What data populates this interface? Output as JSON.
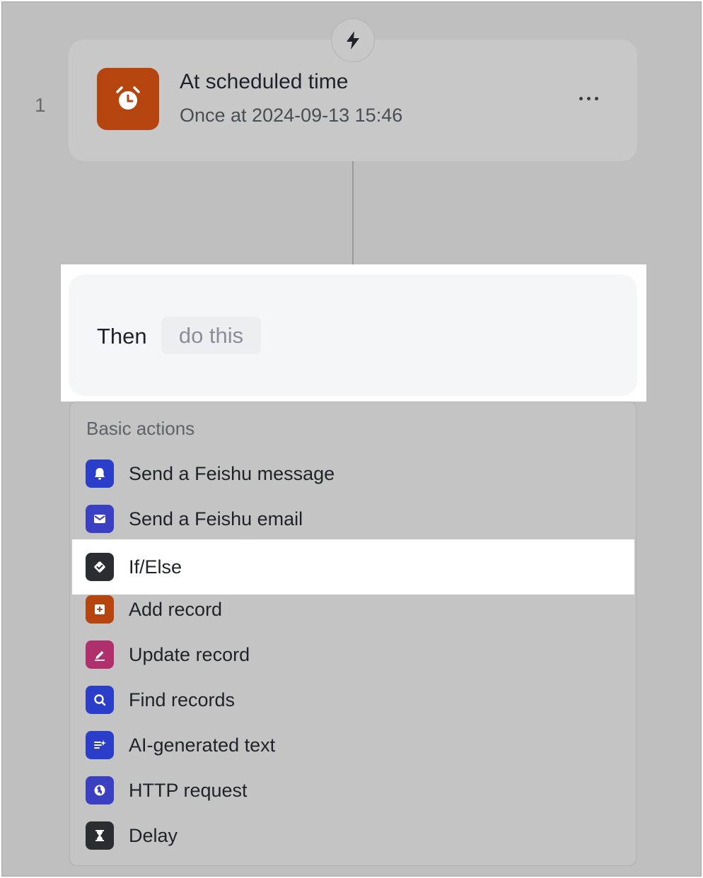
{
  "step": {
    "number": "1"
  },
  "trigger": {
    "title": "At scheduled time",
    "subtitle": "Once at 2024-09-13 15:46",
    "icon": "alarm-clock-icon",
    "icon_color": "#b6440f",
    "badge_icon": "lightning-bolt-icon"
  },
  "then_block": {
    "label": "Then",
    "placeholder": "do this"
  },
  "menu": {
    "section_title": "Basic actions",
    "items": [
      {
        "label": "Send a Feishu message",
        "icon": "bell-icon",
        "color": "#2a3ec9"
      },
      {
        "label": "Send a Feishu email",
        "icon": "envelope-icon",
        "color": "#3b3fc2"
      },
      {
        "label": "If/Else",
        "icon": "check-badge-icon",
        "color": "#2b2d31",
        "selected": true
      },
      {
        "label": "Add record",
        "icon": "plus-square-icon",
        "color": "#b6440f"
      },
      {
        "label": "Update record",
        "icon": "pencil-icon",
        "color": "#b0306e"
      },
      {
        "label": "Find records",
        "icon": "magnifier-icon",
        "color": "#2a3ec9"
      },
      {
        "label": "AI-generated text",
        "icon": "ai-text-icon",
        "color": "#2a3ec9"
      },
      {
        "label": "HTTP request",
        "icon": "globe-icon",
        "color": "#3b3fc2"
      },
      {
        "label": "Delay",
        "icon": "hourglass-icon",
        "color": "#2b2d31"
      }
    ]
  }
}
